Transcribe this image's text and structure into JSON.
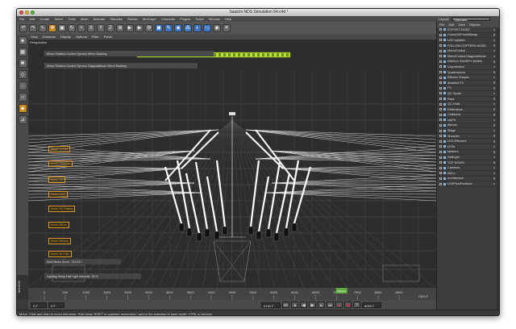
{
  "window": {
    "title": "Saatchi NDS Simulation 64.c4d *"
  },
  "menu": [
    "File",
    "Edit",
    "Create",
    "Select",
    "Tools",
    "Mesh",
    "Animate",
    "Simulate",
    "Render",
    "MoGraph",
    "Character",
    "Plugins",
    "Script",
    "Window",
    "Help"
  ],
  "layout": {
    "label": "Layout:",
    "value": "Standard"
  },
  "viewport": {
    "menu": [
      "View",
      "Cameras",
      "Display",
      "Options",
      "Filter",
      "Panel"
    ],
    "name": "Perspective"
  },
  "attributes": [
    "Mirror Rotation Control Symzzo Mirror Banking",
    "Mirror Rotation Control Symzzo DiagonalMode Mirror Banking"
  ],
  "null_labels": [
    "Mirror Tribute",
    "Mirror Sharpen",
    "Mirror VC",
    "Mirror BKG",
    "Mirror 3D Testing",
    "Mirror Mirror",
    "Mirror Mirrors",
    "Mirror 3D Hidr"
  ],
  "sliders": [
    {
      "label": "Multi Beam Zoom",
      "value": "724.637"
    },
    {
      "label": "Lighting Setup Half Light Intensity",
      "value": "26 %"
    }
  ],
  "timeline": {
    "ticks": [
      "0",
      "500",
      "1000",
      "1500",
      "2000",
      "2500",
      "3000",
      "3500",
      "4000",
      "4500",
      "5000",
      "5500",
      "6000",
      "6500",
      "7000",
      "7500",
      "8000",
      "8500"
    ],
    "current": "7024 F",
    "end": "7024 F"
  },
  "transport": {
    "start": "0 F",
    "min": "0 F",
    "frame": "6150 F",
    "max": "8050 F"
  },
  "status": "Move: Click and drag to move elements. Hold down SHIFT to quantize movement / add to the selection in point mode, CTRL to remove.",
  "brand": "MAXON",
  "object_manager": {
    "tabs": [
      "File",
      "Edit",
      "View",
      "Objects"
    ],
    "items": [
      "EXPORT MODE",
      "ColorA3DFromBitmap",
      "LED Updater",
      "FOLLOW COPTERS MODE",
      "MirrorControl",
      "MirrorControl.DiagonalMode",
      "SINGLE SHARPY MODE",
      "Unprotected",
      "Quadcopters",
      "Effector Shapes",
      "disabled FX",
      "FX",
      "QC-Spots",
      "Rays",
      "QC-Hulls",
      "Reflections",
      "Collisions",
      "rayFix",
      "Mirrors",
      "Stage",
      "Sharpies",
      "LED-Effectors",
      "LEDs",
      "Masters",
      "HallLight",
      "TOP DOWN",
      "Cameras",
      "NULL",
      "Architecture",
      "LEDPixelPositions"
    ]
  },
  "colors": {
    "accent": "#c88a1d",
    "highlight": "#b7e03a"
  }
}
